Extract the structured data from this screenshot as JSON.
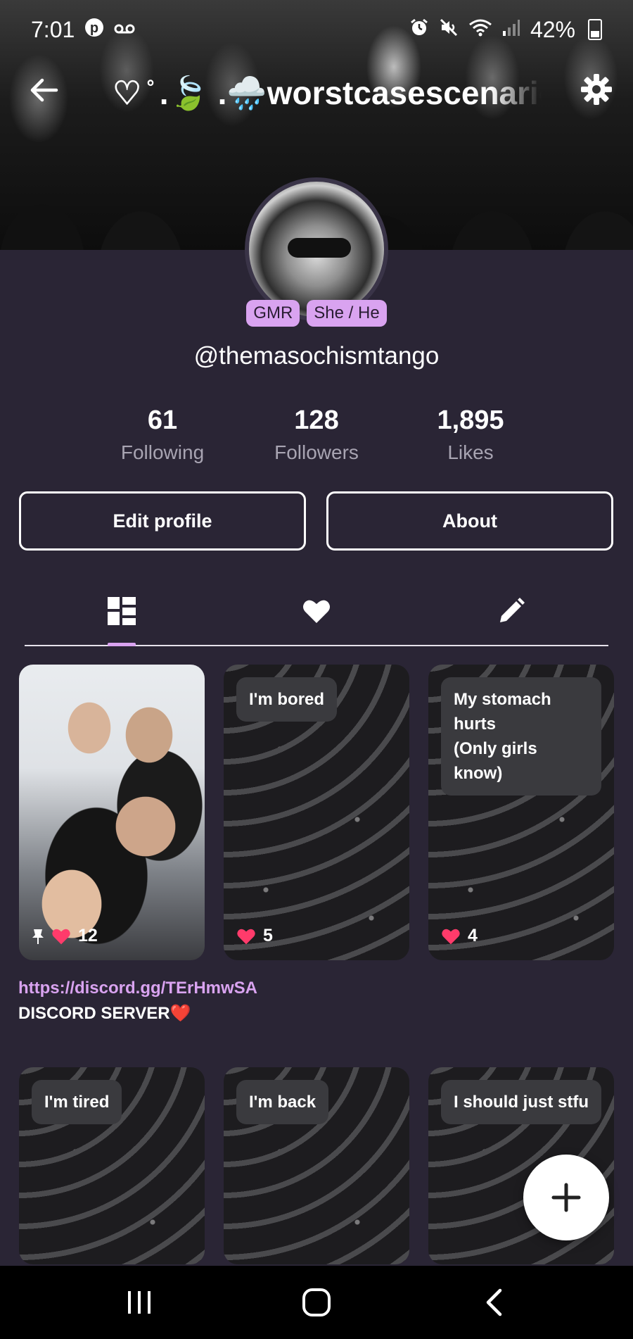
{
  "status_bar": {
    "time": "7:01",
    "battery_percent": "42%",
    "icons": [
      "pinterest-icon",
      "voicemail-icon",
      "alarm-icon",
      "mute-icon",
      "wifi-icon",
      "signal-icon",
      "battery-icon"
    ]
  },
  "header": {
    "title": "♡ ̊ .🍃 .🌧️worstcasescenario"
  },
  "profile": {
    "badges": [
      "GMR",
      "She / He"
    ],
    "username": "@themasochismtango"
  },
  "stats": [
    {
      "value": "61",
      "label": "Following"
    },
    {
      "value": "128",
      "label": "Followers"
    },
    {
      "value": "1,895",
      "label": "Likes"
    }
  ],
  "buttons": {
    "edit_profile": "Edit profile",
    "about": "About"
  },
  "tabs": [
    "posts-grid-icon",
    "heart-icon",
    "pencil-icon"
  ],
  "posts": [
    {
      "text": "",
      "likes": "12",
      "pinned": true
    },
    {
      "text": "I'm bored",
      "likes": "5"
    },
    {
      "text": "My stomach hurts\n(Only girls know)",
      "likes": "4"
    },
    {
      "text": "I'm tired"
    },
    {
      "text": "I'm back"
    },
    {
      "text": "I should just stfu"
    }
  ],
  "caption": {
    "link": "https://discord.gg/TErHmwSA",
    "text": " DISCORD SERVER❤️"
  },
  "colors": {
    "background": "#2a2535",
    "accent": "#d9a3f0",
    "like_heart": "#ff3b6b"
  }
}
